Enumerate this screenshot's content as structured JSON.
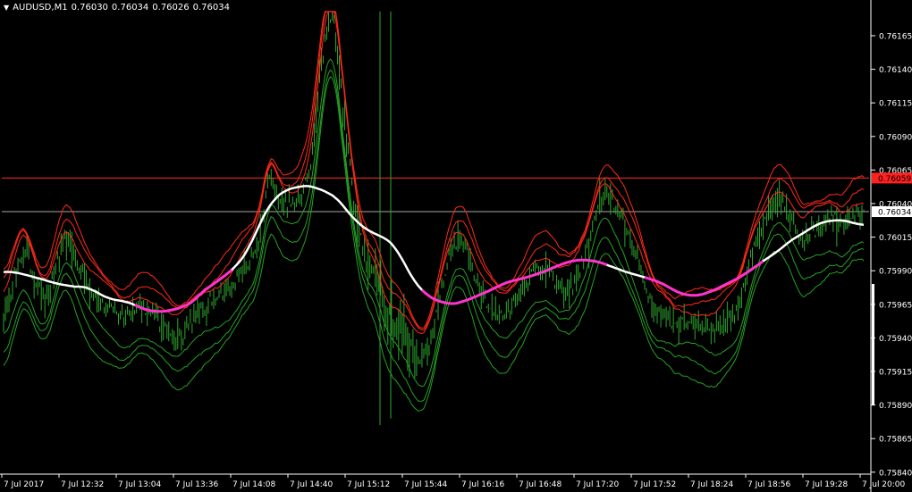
{
  "window": {
    "symbol_label": "AUDUSD,M1",
    "ohlc": [
      "0.76030",
      "0.76034",
      "0.76026",
      "0.76034"
    ],
    "caret_icon": "caret-down-icon"
  },
  "colors": {
    "background": "#000000",
    "axis_text": "#ffffff",
    "axis_line": "#ffffff",
    "candle": "#2ea82e",
    "band_upper": "#ff2a1a",
    "band_lower": "#25a125",
    "ma_line": "#ffffff",
    "ma_flat": "#ff33cc",
    "h_line_red": "#ff3020",
    "h_line_gray": "#a8a8a8",
    "tag_red_bg": "#ff2020",
    "tag_white_bg": "#ffffff"
  },
  "price_axis": {
    "labels": [
      "0.76165",
      "0.76140",
      "0.76115",
      "0.76090",
      "0.76065",
      "0.76040",
      "0.76015",
      "0.75990",
      "0.75965",
      "0.75940",
      "0.75915",
      "0.75890",
      "0.75865",
      "0.75840"
    ],
    "red_line_price": "0.76059",
    "current_price": "0.76034"
  },
  "time_axis": {
    "labels": [
      "7 Jul 2017",
      "7 Jul 12:32",
      "7 Jul 13:04",
      "7 Jul 13:36",
      "7 Jul 14:08",
      "7 Jul 14:40",
      "7 Jul 15:12",
      "7 Jul 15:44",
      "7 Jul 16:16",
      "7 Jul 16:48",
      "7 Jul 17:20",
      "7 Jul 17:52",
      "7 Jul 18:24",
      "7 Jul 18:56",
      "7 Jul 19:28",
      "7 Jul 20:00"
    ]
  },
  "chart_data": {
    "type": "line",
    "ylim": [
      0.75835,
      0.76183
    ],
    "x_labels": [
      "7 Jul 2017",
      "7 Jul 12:32",
      "7 Jul 13:04",
      "7 Jul 13:36",
      "7 Jul 14:08",
      "7 Jul 14:40",
      "7 Jul 15:12",
      "7 Jul 15:44",
      "7 Jul 16:16",
      "7 Jul 16:48",
      "7 Jul 17:20",
      "7 Jul 17:52",
      "7 Jul 18:24",
      "7 Jul 18:56",
      "7 Jul 19:28",
      "7 Jul 20:00"
    ],
    "series": [
      {
        "values": [
          0.75955,
          0.75985,
          0.76005,
          0.75982,
          0.75965,
          0.75998,
          0.76015,
          0.75995,
          0.75975,
          0.7597,
          0.75962,
          0.75958,
          0.7596,
          0.75965,
          0.75955,
          0.7595,
          0.7594,
          0.75945,
          0.75955,
          0.75962,
          0.75972,
          0.75975,
          0.75985,
          0.75995,
          0.76005,
          0.7606,
          0.76045,
          0.76038,
          0.76048,
          0.7607,
          0.7615,
          0.76185,
          0.7611,
          0.7604,
          0.76,
          0.7599,
          0.7596,
          0.7595,
          0.7594,
          0.75925,
          0.7593,
          0.7597,
          0.76005,
          0.76015,
          0.75995,
          0.75975,
          0.7596,
          0.75955,
          0.75965,
          0.7598,
          0.7599,
          0.75995,
          0.7598,
          0.75975,
          0.75985,
          0.76005,
          0.7604,
          0.76048,
          0.7603,
          0.76015,
          0.7599,
          0.75965,
          0.75955,
          0.75952,
          0.7595,
          0.75952,
          0.7595,
          0.75945,
          0.75955,
          0.7596,
          0.7599,
          0.76015,
          0.7603,
          0.76045,
          0.7603,
          0.76015,
          0.76018,
          0.76025,
          0.7603,
          0.76025,
          0.76035,
          0.7603
        ]
      }
    ]
  }
}
